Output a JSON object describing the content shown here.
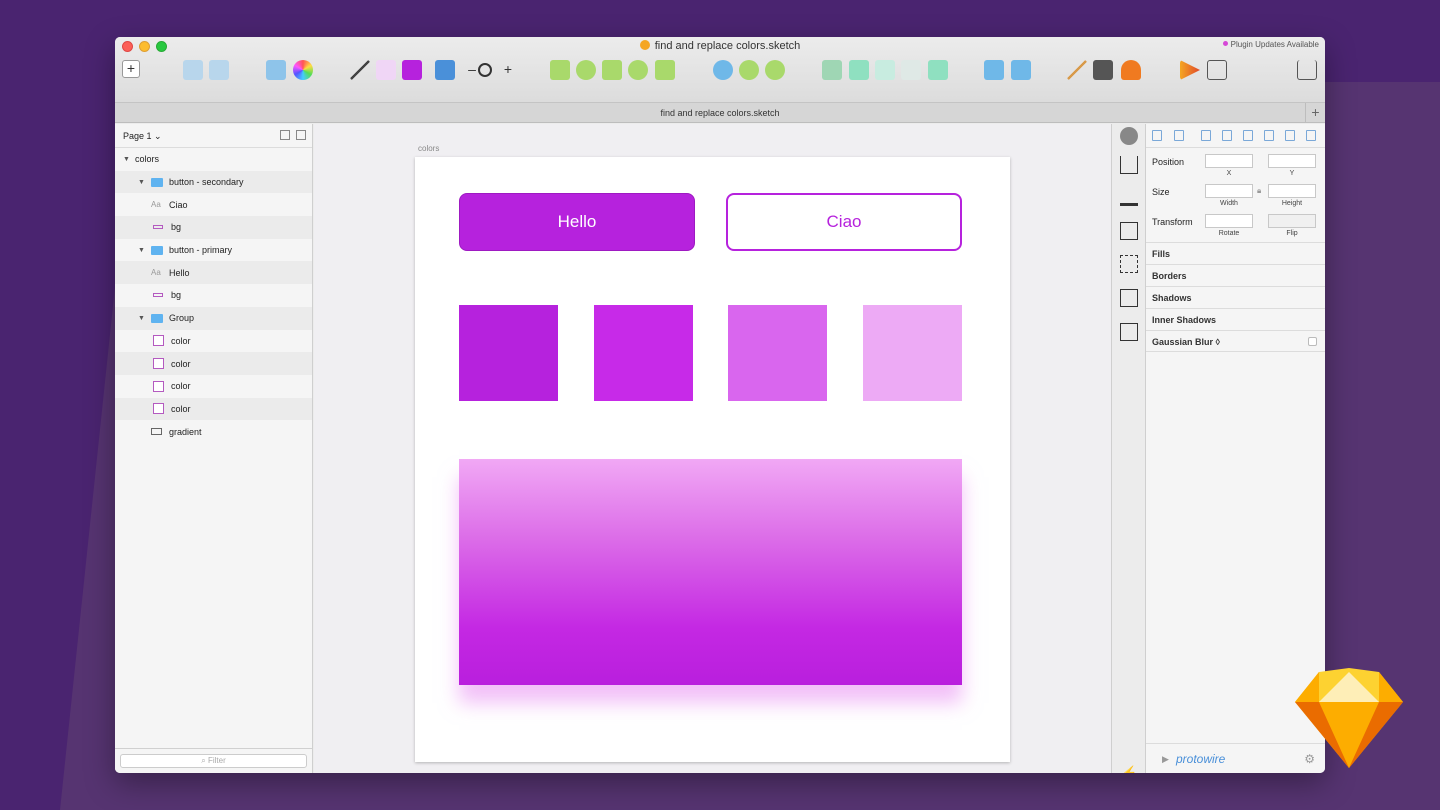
{
  "window": {
    "title": "find and replace colors.sketch",
    "tab_title": "find and replace colors.sketch",
    "plugin_badge": "Plugin Updates Available"
  },
  "toolbar": {
    "zoom_minus": "–",
    "zoom_plus": "+",
    "tab_add": "+"
  },
  "sidebar": {
    "page_selector": "Page 1 ⌄",
    "filter_placeholder": "Filter",
    "layers": [
      {
        "label": "colors",
        "type": "artboard",
        "depth": 0,
        "expanded": true
      },
      {
        "label": "button - secondary",
        "type": "folder",
        "depth": 1,
        "expanded": true
      },
      {
        "label": "Ciao",
        "type": "text",
        "depth": 2
      },
      {
        "label": "bg",
        "type": "shape",
        "depth": 2
      },
      {
        "label": "button - primary",
        "type": "folder",
        "depth": 1,
        "expanded": true
      },
      {
        "label": "Hello",
        "type": "text",
        "depth": 2
      },
      {
        "label": "bg",
        "type": "shape",
        "depth": 2
      },
      {
        "label": "Group",
        "type": "folder",
        "depth": 1,
        "expanded": true
      },
      {
        "label": "color",
        "type": "square",
        "depth": 2
      },
      {
        "label": "color",
        "type": "square",
        "depth": 2
      },
      {
        "label": "color",
        "type": "square",
        "depth": 2
      },
      {
        "label": "color",
        "type": "square",
        "depth": 2
      },
      {
        "label": "gradient",
        "type": "rect",
        "depth": 1
      }
    ]
  },
  "canvas": {
    "artboard_label": "colors",
    "primary_button": "Hello",
    "secondary_button": "Ciao",
    "swatches": [
      "#b622dd",
      "#c72ae8",
      "#d966ee",
      "#edaaf5"
    ],
    "accent": "#b622dd"
  },
  "inspector": {
    "position_label": "Position",
    "size_label": "Size",
    "transform_label": "Transform",
    "x_label": "X",
    "y_label": "Y",
    "width_label": "Width",
    "height_label": "Height",
    "rotate_label": "Rotate",
    "flip_label": "Flip",
    "sections": [
      "Fills",
      "Borders",
      "Shadows",
      "Inner Shadows",
      "Gaussian Blur ◊"
    ],
    "plugin_name": "protowire"
  }
}
